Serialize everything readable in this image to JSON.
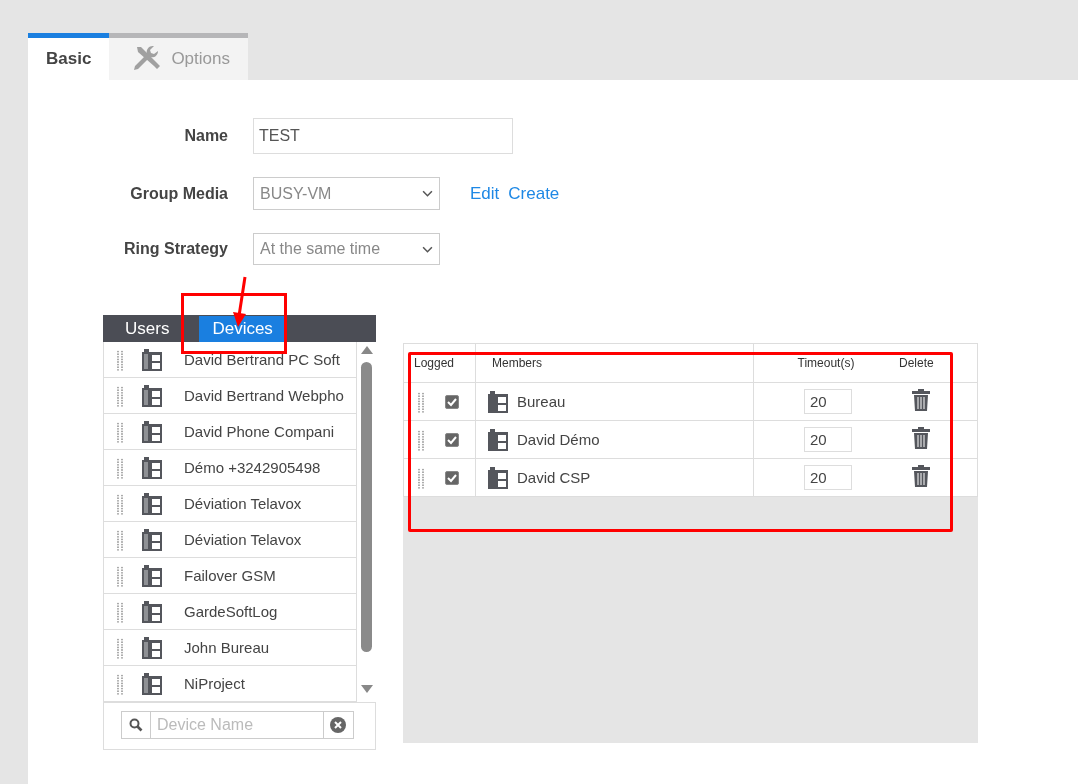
{
  "tabs": [
    {
      "label": "Basic",
      "selected": true
    },
    {
      "label": "Options",
      "selected": false
    }
  ],
  "form": [
    {
      "kind": "text",
      "label": "Name",
      "value": "TEST"
    },
    {
      "kind": "select",
      "label": "Group Media",
      "value": "BUSY-VM",
      "links": [
        "Edit",
        "Create"
      ]
    },
    {
      "kind": "select",
      "label": "Ring Strategy",
      "value": "At the same time"
    }
  ],
  "picker": {
    "tabs": [
      {
        "label": "Users",
        "selected": false
      },
      {
        "label": "Devices",
        "selected": true
      }
    ],
    "items": [
      "David Bertrand PC Soft",
      "David Bertrand Webpho",
      "David Phone Compani",
      "Démo +3242905498",
      "Déviation Telavox",
      "Déviation Telavox",
      "Failover GSM",
      "GardeSoftLog",
      "John Bureau",
      "NiProject"
    ],
    "search": {
      "placeholder": "Device Name"
    }
  },
  "members": {
    "columns": [
      "Logged",
      "Members",
      "Timeout(s)",
      "Delete"
    ],
    "rows": [
      {
        "logged": true,
        "name": "Bureau",
        "timeout": "20"
      },
      {
        "logged": true,
        "name": "David Démo",
        "timeout": "20"
      },
      {
        "logged": true,
        "name": "David CSP",
        "timeout": "20"
      }
    ]
  }
}
